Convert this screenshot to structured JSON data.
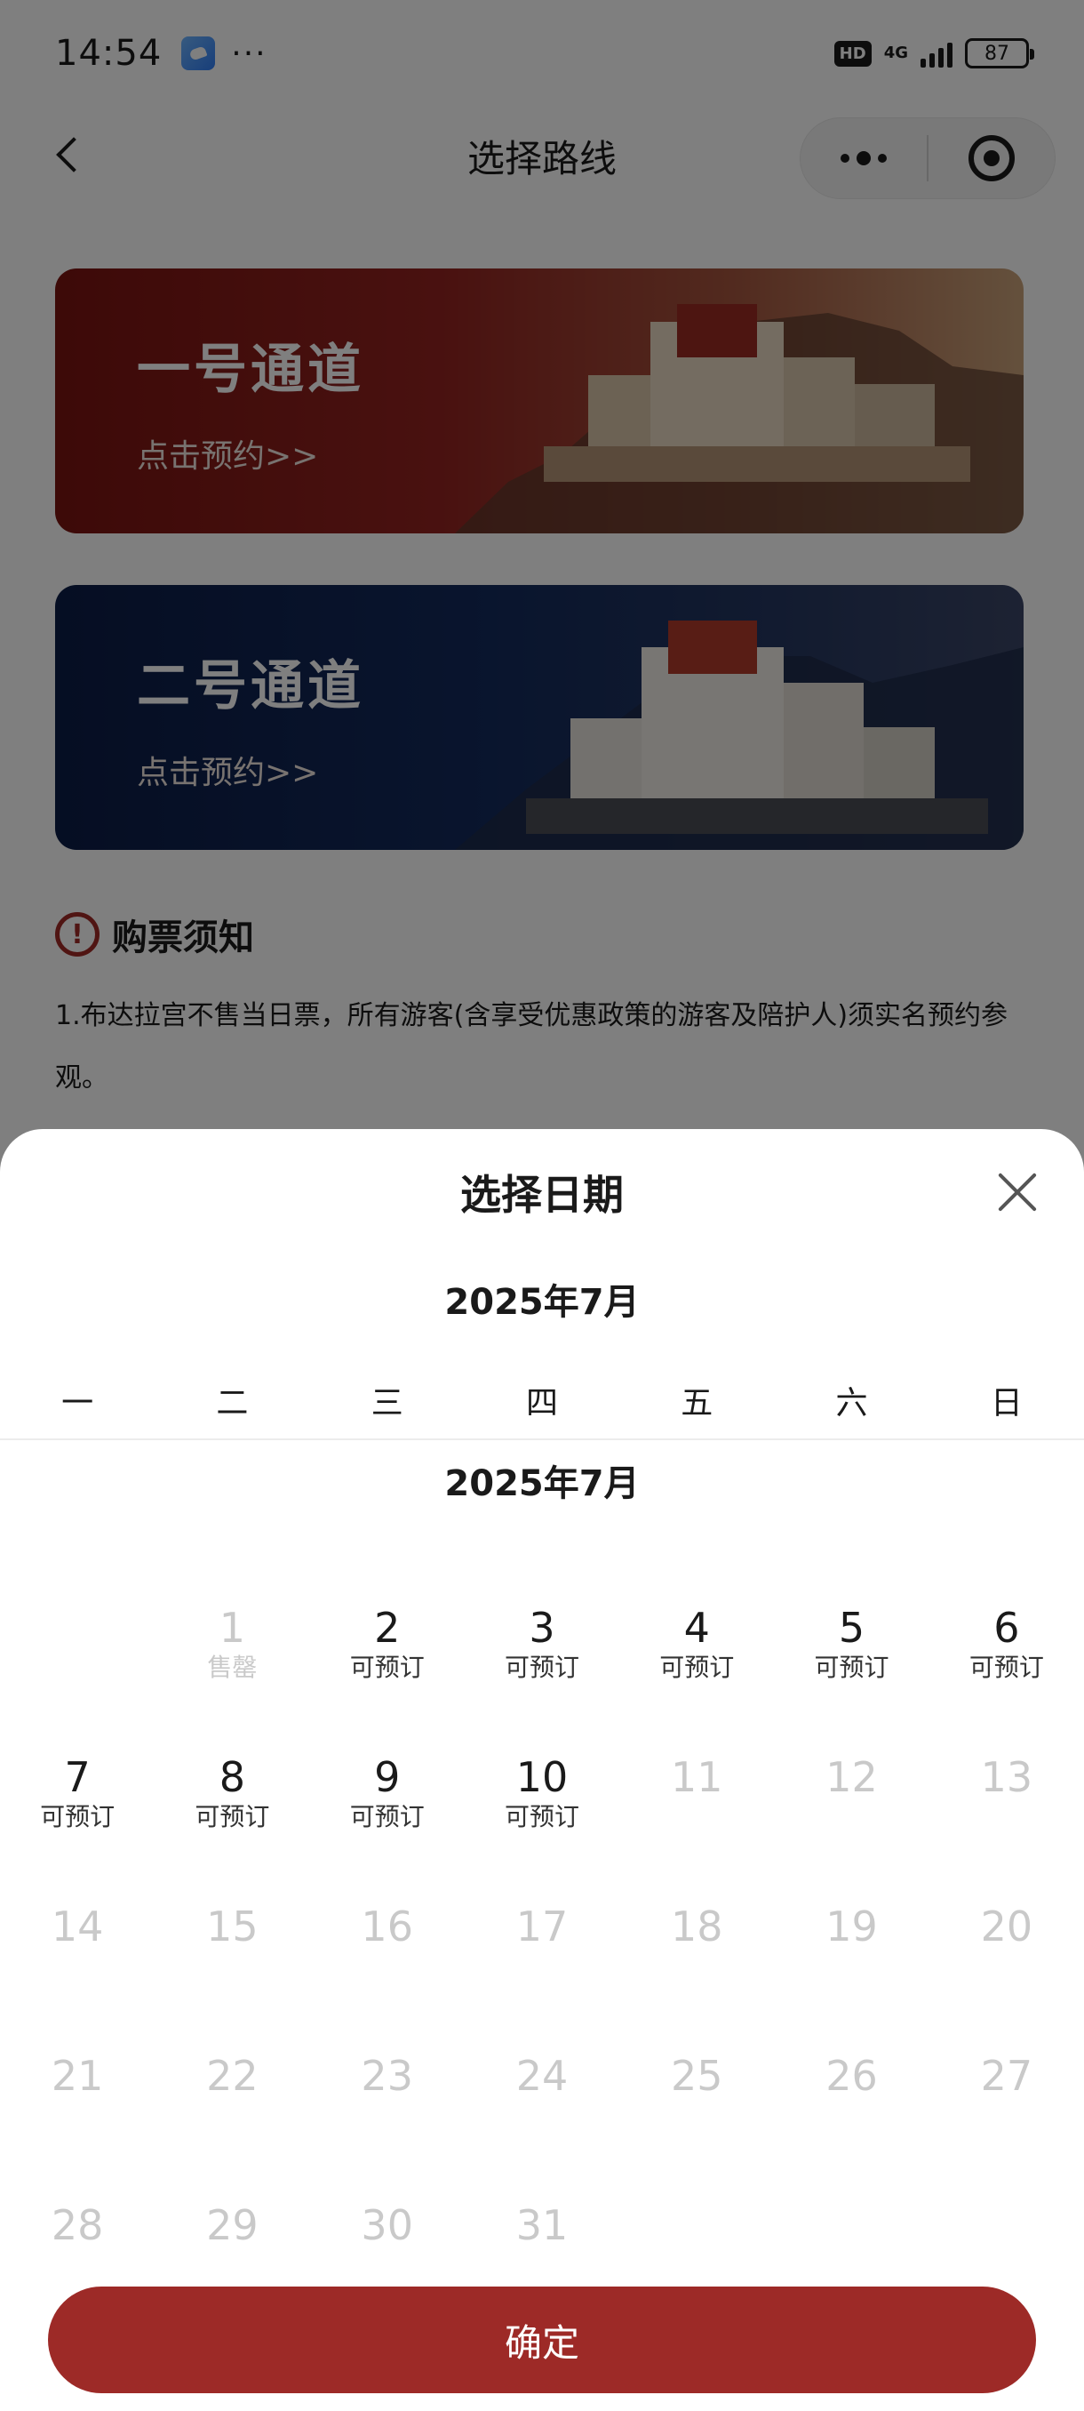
{
  "status_bar": {
    "time": "14:54",
    "more": "···",
    "hd": "HD",
    "network": "4G",
    "battery": "87"
  },
  "nav": {
    "title": "选择路线"
  },
  "routes": [
    {
      "title": "一号通道",
      "subtitle": "点击预约>>"
    },
    {
      "title": "二号通道",
      "subtitle": "点击预约>>"
    }
  ],
  "notice": {
    "title": "购票须知",
    "icon_text": "!",
    "text": "1.布达拉宫不售当日票，所有游客(含享受优惠政策的游客及陪护人)须实名预约参观。"
  },
  "sheet": {
    "title": "选择日期",
    "month_header": "2025年7月",
    "month_label": "2025年7月",
    "weekdays": [
      "一",
      "二",
      "三",
      "四",
      "五",
      "六",
      "日"
    ],
    "confirm_label": "确定"
  },
  "calendar": {
    "leading_blanks": 1,
    "days": [
      {
        "day": "1",
        "status": "售罄",
        "state": "disabled"
      },
      {
        "day": "2",
        "status": "可预订",
        "state": "available"
      },
      {
        "day": "3",
        "status": "可预订",
        "state": "available"
      },
      {
        "day": "4",
        "status": "可预订",
        "state": "available"
      },
      {
        "day": "5",
        "status": "可预订",
        "state": "available"
      },
      {
        "day": "6",
        "status": "可预订",
        "state": "available"
      },
      {
        "day": "7",
        "status": "可预订",
        "state": "available"
      },
      {
        "day": "8",
        "status": "可预订",
        "state": "available"
      },
      {
        "day": "9",
        "status": "可预订",
        "state": "available"
      },
      {
        "day": "10",
        "status": "可预订",
        "state": "available"
      },
      {
        "day": "11",
        "status": "",
        "state": "unavailable"
      },
      {
        "day": "12",
        "status": "",
        "state": "unavailable"
      },
      {
        "day": "13",
        "status": "",
        "state": "unavailable"
      },
      {
        "day": "14",
        "status": "",
        "state": "unavailable"
      },
      {
        "day": "15",
        "status": "",
        "state": "unavailable"
      },
      {
        "day": "16",
        "status": "",
        "state": "unavailable"
      },
      {
        "day": "17",
        "status": "",
        "state": "unavailable"
      },
      {
        "day": "18",
        "status": "",
        "state": "unavailable"
      },
      {
        "day": "19",
        "status": "",
        "state": "unavailable"
      },
      {
        "day": "20",
        "status": "",
        "state": "unavailable"
      },
      {
        "day": "21",
        "status": "",
        "state": "unavailable"
      },
      {
        "day": "22",
        "status": "",
        "state": "unavailable"
      },
      {
        "day": "23",
        "status": "",
        "state": "unavailable"
      },
      {
        "day": "24",
        "status": "",
        "state": "unavailable"
      },
      {
        "day": "25",
        "status": "",
        "state": "unavailable"
      },
      {
        "day": "26",
        "status": "",
        "state": "unavailable"
      },
      {
        "day": "27",
        "status": "",
        "state": "unavailable"
      },
      {
        "day": "28",
        "status": "",
        "state": "unavailable"
      },
      {
        "day": "29",
        "status": "",
        "state": "unavailable"
      },
      {
        "day": "30",
        "status": "",
        "state": "unavailable"
      },
      {
        "day": "31",
        "status": "",
        "state": "unavailable"
      }
    ]
  },
  "colors": {
    "accent": "#9d2a27",
    "available_text": "#1a1a1a",
    "disabled_text": "#c9c9c9"
  }
}
